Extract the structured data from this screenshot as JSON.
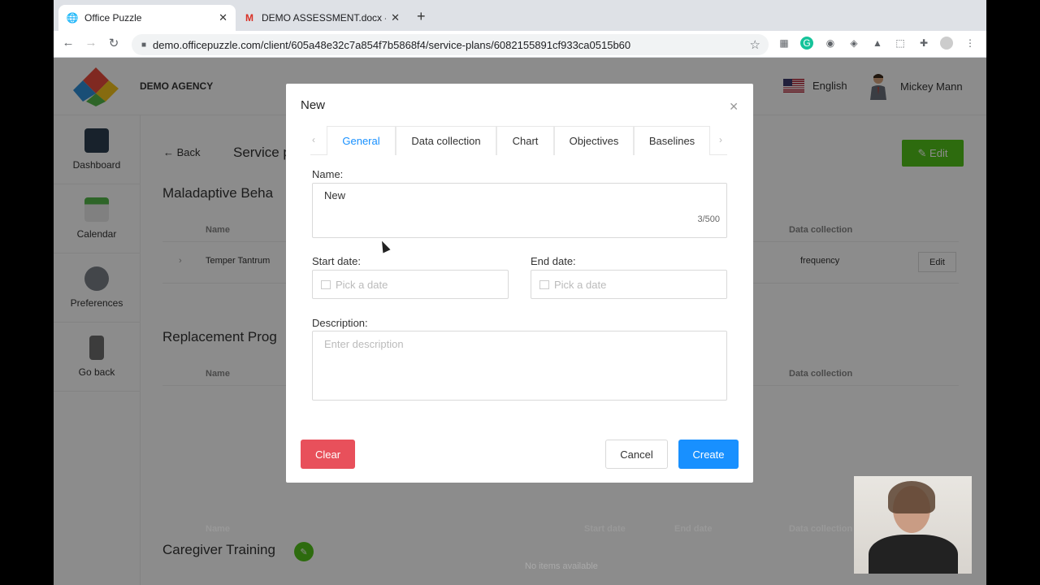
{
  "browser": {
    "tabs": [
      {
        "title": "Office Puzzle",
        "active": true
      },
      {
        "title": "DEMO ASSESSMENT.docx - ha",
        "active": false
      }
    ],
    "url": "demo.officepuzzle.com/client/605a48e32c7a854f7b5868f4/service-plans/6082155891cf933ca0515b60"
  },
  "header": {
    "agency": "DEMO AGENCY",
    "language": "English",
    "user": "Mickey Mann"
  },
  "sidebar": {
    "items": [
      {
        "label": "Dashboard"
      },
      {
        "label": "Calendar"
      },
      {
        "label": "Preferences"
      },
      {
        "label": "Go back"
      }
    ]
  },
  "page": {
    "back": "Back",
    "title": "Service p",
    "edit": "Edit",
    "sections": [
      {
        "title": "Maladaptive Beha"
      },
      {
        "title": "Replacement Prog"
      },
      {
        "title": "Caregiver Training"
      }
    ],
    "columns": {
      "name": "Name",
      "data_collection": "Data collection",
      "start_date": "Start date",
      "end_date": "End date"
    },
    "row": {
      "name": "Temper Tantrum",
      "data_collection": "frequency",
      "edit": "Edit"
    },
    "empty": "No items available"
  },
  "modal": {
    "title": "New",
    "tabs": [
      "General",
      "Data collection",
      "Chart",
      "Objectives",
      "Baselines"
    ],
    "name_label": "Name:",
    "name_value": "New",
    "name_count": "3/500",
    "start_label": "Start date:",
    "end_label": "End date:",
    "date_placeholder": "Pick a date",
    "description_label": "Description:",
    "description_placeholder": "Enter description",
    "clear": "Clear",
    "cancel": "Cancel",
    "create": "Create"
  },
  "colors": {
    "primary": "#1890ff",
    "danger": "#e8505b",
    "success": "#52c41a"
  }
}
